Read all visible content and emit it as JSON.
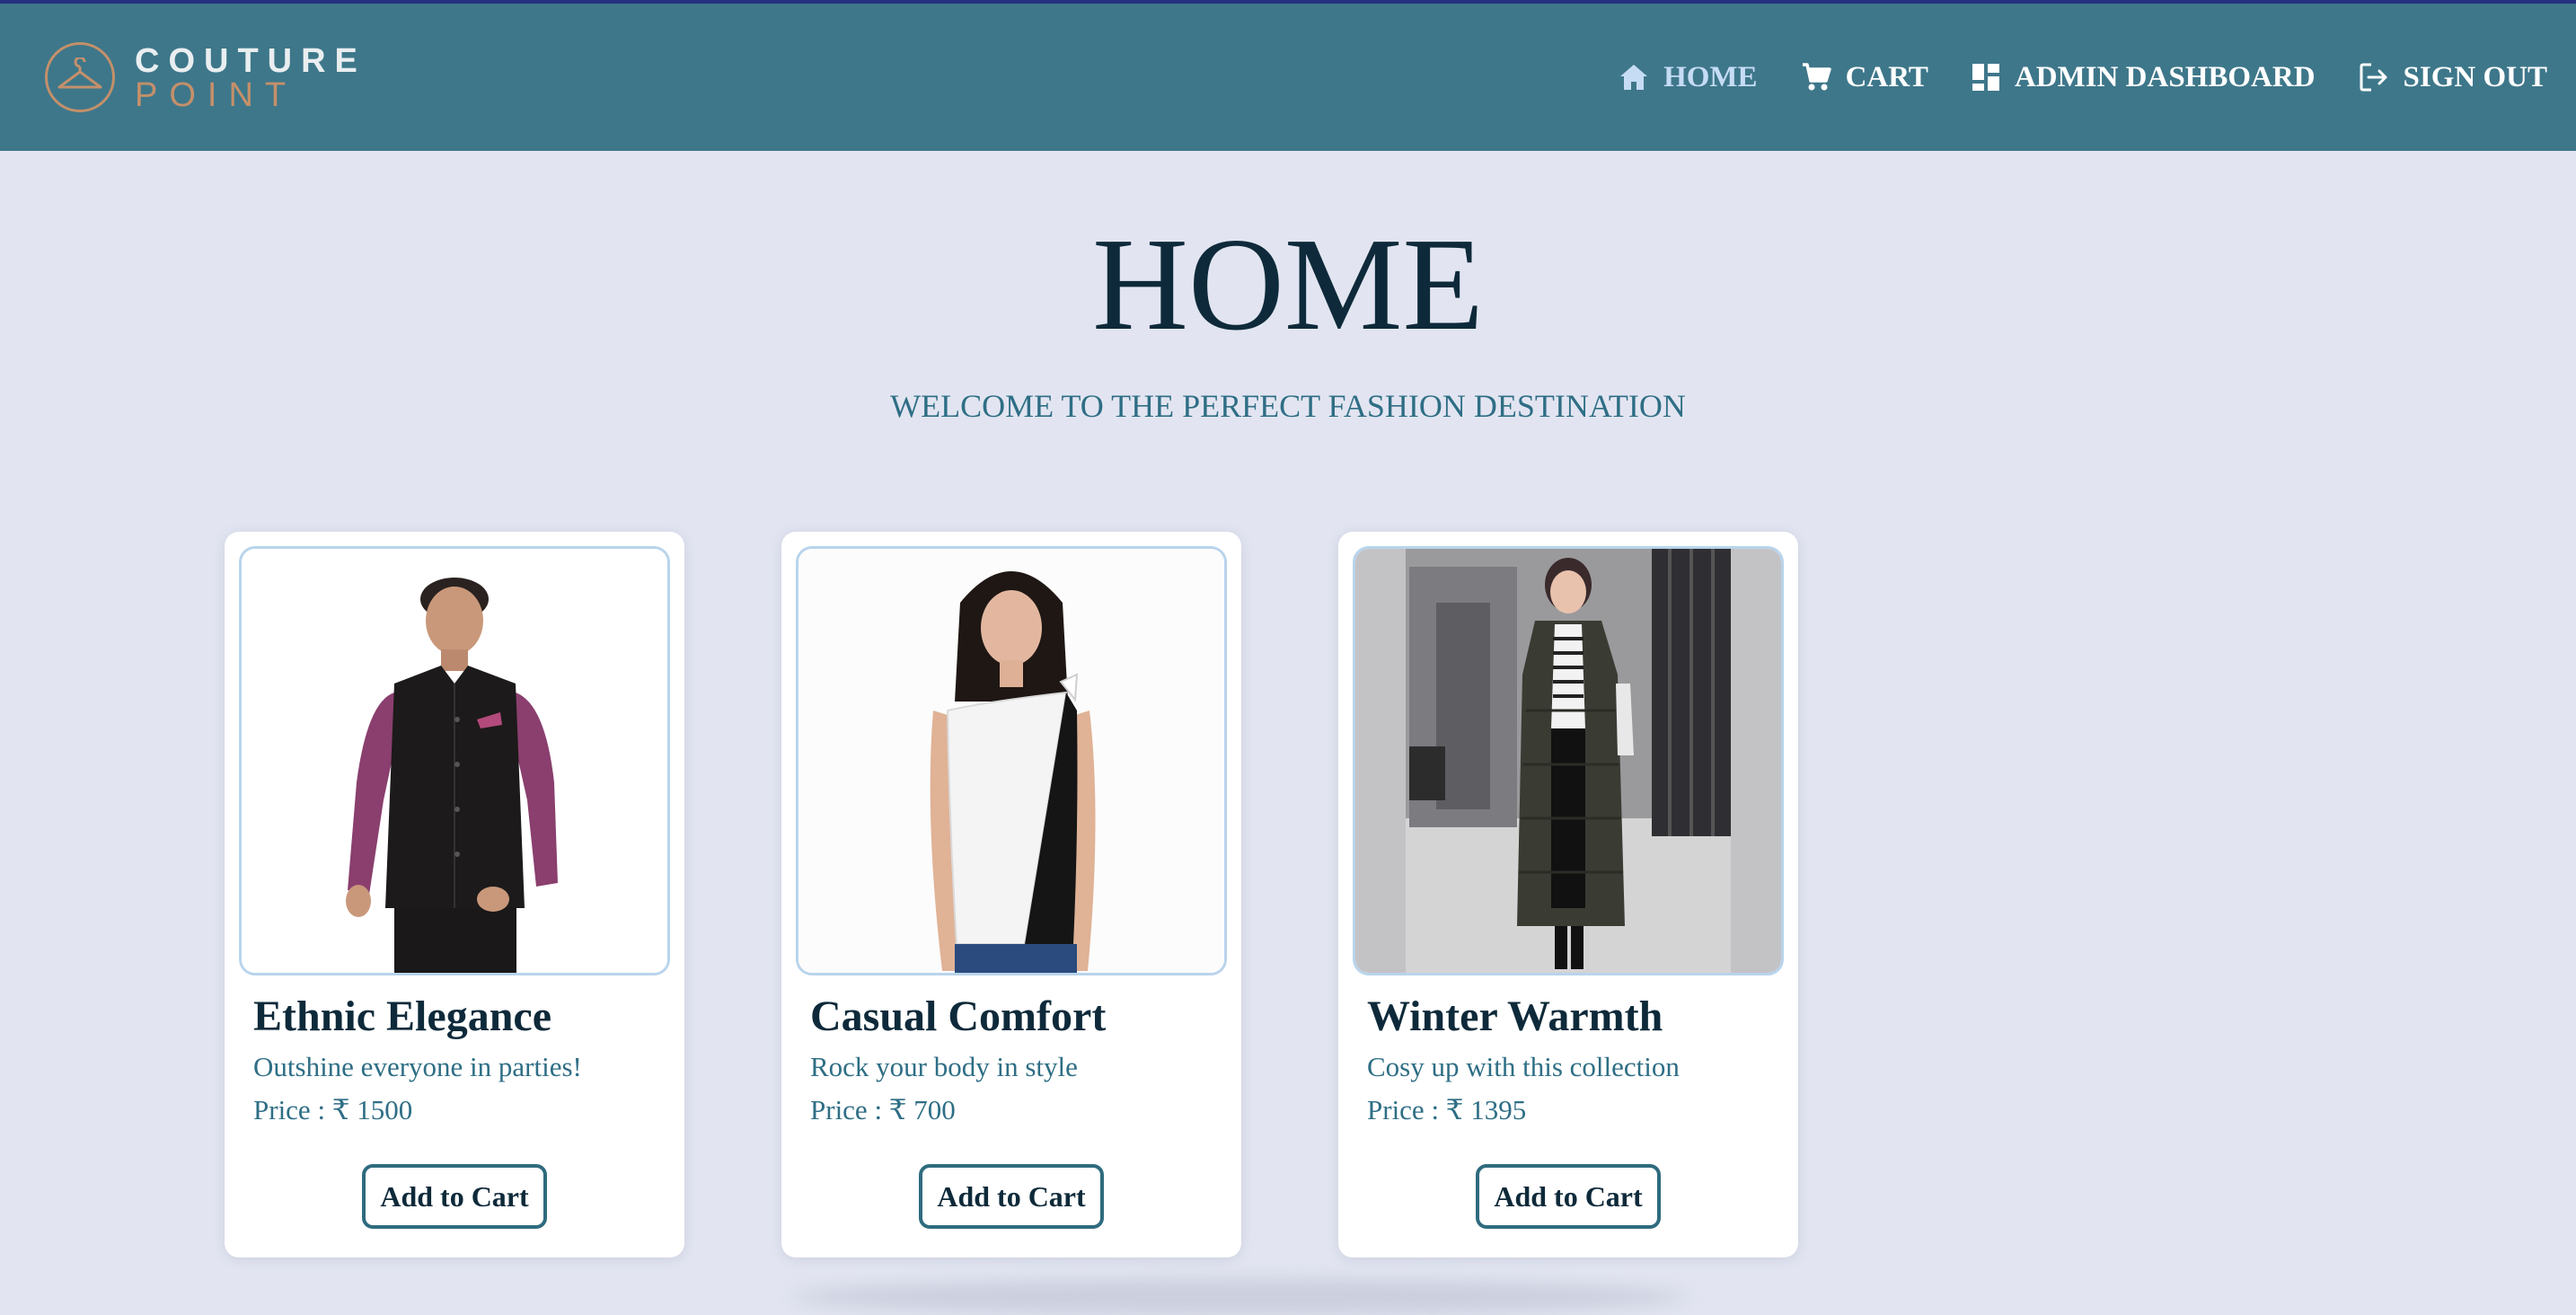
{
  "brand": {
    "line1": "COUTURE",
    "line2": "POINT"
  },
  "nav": {
    "home": "HOME",
    "cart": "CART",
    "admin": "ADMIN DASHBOARD",
    "signout": "SIGN OUT"
  },
  "page": {
    "title": "HOME",
    "subtitle": "WELCOME TO THE PERFECT FASHION DESTINATION"
  },
  "products": [
    {
      "name": "Ethnic Elegance",
      "description": "Outshine everyone in parties!",
      "price": "Price : ₹ 1500",
      "button": "Add to Cart"
    },
    {
      "name": "Casual Comfort",
      "description": "Rock your body in style",
      "price": "Price : ₹ 700",
      "button": "Add to Cart"
    },
    {
      "name": "Winter Warmth",
      "description": "Cosy up with this collection",
      "price": "Price : ₹ 1395",
      "button": "Add to Cart"
    }
  ],
  "colors": {
    "navbar": "#3e778a",
    "background": "#e2e5f1",
    "heading": "#0e2a3a",
    "accent": "#2e6e85",
    "logo_accent": "#c4906a"
  },
  "icons": [
    "hanger-icon",
    "home-icon",
    "cart-icon",
    "dashboard-icon",
    "sign-out-icon"
  ]
}
